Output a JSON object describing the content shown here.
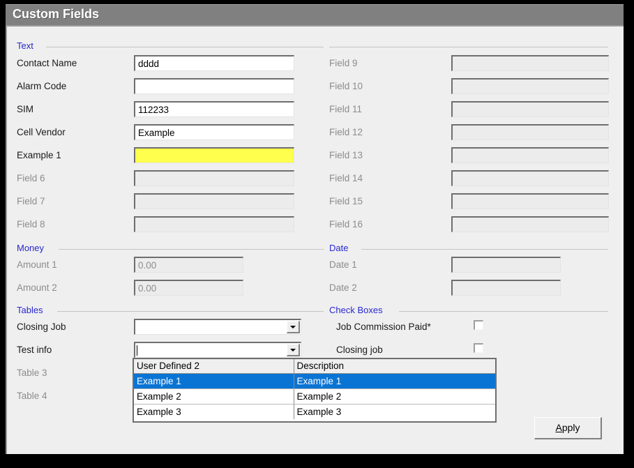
{
  "window": {
    "title": "Custom Fields"
  },
  "groups": {
    "text": "Text",
    "money": "Money",
    "tables": "Tables",
    "date": "Date",
    "checkboxes": "Check Boxes"
  },
  "text_fields_left": [
    {
      "label": "Contact Name",
      "value": "dddd",
      "disabled": false,
      "highlight": false
    },
    {
      "label": "Alarm Code",
      "value": "",
      "disabled": false,
      "highlight": false
    },
    {
      "label": "SIM",
      "value": "112233",
      "disabled": false,
      "highlight": false
    },
    {
      "label": "Cell Vendor",
      "value": "Example",
      "disabled": false,
      "highlight": false
    },
    {
      "label": "Example 1",
      "value": "",
      "disabled": false,
      "highlight": true
    },
    {
      "label": "Field 6",
      "value": "",
      "disabled": true,
      "highlight": false
    },
    {
      "label": "Field 7",
      "value": "",
      "disabled": true,
      "highlight": false
    },
    {
      "label": "Field 8",
      "value": "",
      "disabled": true,
      "highlight": false
    }
  ],
  "text_fields_right": [
    {
      "label": "Field 9",
      "value": "",
      "disabled": true
    },
    {
      "label": "Field 10",
      "value": "",
      "disabled": true
    },
    {
      "label": "Field 11",
      "value": "",
      "disabled": true
    },
    {
      "label": "Field 12",
      "value": "",
      "disabled": true
    },
    {
      "label": "Field 13",
      "value": "",
      "disabled": true
    },
    {
      "label": "Field 14",
      "value": "",
      "disabled": true
    },
    {
      "label": "Field 15",
      "value": "",
      "disabled": true
    },
    {
      "label": "Field 16",
      "value": "",
      "disabled": true
    }
  ],
  "money_fields": [
    {
      "label": "Amount 1",
      "value": "0.00",
      "disabled": true
    },
    {
      "label": "Amount 2",
      "value": "0.00",
      "disabled": true
    }
  ],
  "date_fields": [
    {
      "label": "Date 1",
      "value": "",
      "disabled": true
    },
    {
      "label": "Date 2",
      "value": "",
      "disabled": true
    }
  ],
  "table_fields": [
    {
      "label": "Closing Job",
      "value": "",
      "disabled": false,
      "has_combo": true,
      "focused": false
    },
    {
      "label": "Test info",
      "value": "",
      "disabled": false,
      "has_combo": true,
      "focused": true
    },
    {
      "label": "Table 3",
      "value": "",
      "disabled": true,
      "has_combo": false,
      "focused": false
    },
    {
      "label": "Table 4",
      "value": "",
      "disabled": true,
      "has_combo": false,
      "focused": false
    }
  ],
  "checkbox_fields": [
    {
      "label": "Job Commission Paid*",
      "checked": false
    },
    {
      "label": "Closing job",
      "checked": false
    }
  ],
  "dropdown": {
    "columns": [
      "User Defined 2",
      "Description"
    ],
    "rows": [
      {
        "cells": [
          "Example 1",
          "Example 1"
        ],
        "selected": true
      },
      {
        "cells": [
          "Example 2",
          "Example 2"
        ],
        "selected": false
      },
      {
        "cells": [
          "Example 3",
          "Example 3"
        ],
        "selected": false
      }
    ]
  },
  "buttons": {
    "apply": "Apply",
    "apply_accel": "A",
    "apply_rest": "pply"
  },
  "colors": {
    "titlebar": "#808080",
    "group_header_text": "#2727d0",
    "highlight_field": "#ffff4d",
    "selection": "#0a74d4",
    "dialog_face": "#efefef"
  }
}
